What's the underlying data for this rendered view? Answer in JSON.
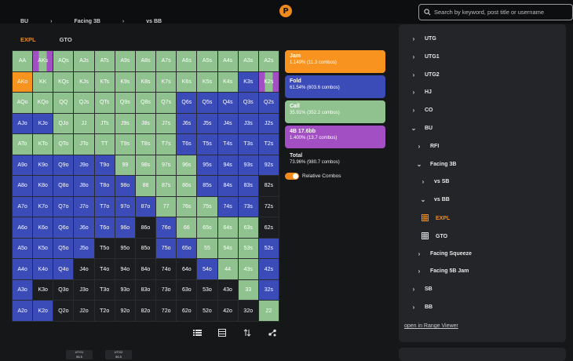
{
  "search": {
    "placeholder": "Search by keyword, post title or username"
  },
  "breadcrumb": {
    "items": [
      "BU",
      "Facing 3B",
      "vs BB"
    ]
  },
  "tabs": [
    {
      "label": "EXPL"
    },
    {
      "label": "GTO"
    }
  ],
  "legend": {
    "jam": {
      "label": "Jam",
      "value": "1.149% (11.3 combos)"
    },
    "fold": {
      "label": "Fold",
      "value": "61.54% (603.6 combos)"
    },
    "call": {
      "label": "Call",
      "value": "35.91% (352.2 combos)"
    },
    "fourbet": {
      "label": "4B 17.6bb",
      "value": "1.400% (13.7 combos)"
    },
    "total": {
      "label": "Total",
      "value": "73.96% (980.7 combos)"
    },
    "relative_combos": "Relative Combos"
  },
  "colors": {
    "jam": "#f7931e",
    "fold": "#3b4bb8",
    "call": "#8fc28e",
    "fourbet": "#a34fc4",
    "null": "#1c1d20",
    "accent": "#f08a1c"
  },
  "hand_grid": {
    "rows": [
      [
        "AA",
        "AKs",
        "AQs",
        "AJs",
        "ATs",
        "A9s",
        "A8s",
        "A7s",
        "A6s",
        "A5s",
        "A4s",
        "A3s",
        "A2s"
      ],
      [
        "AKo",
        "KK",
        "KQs",
        "KJs",
        "KTs",
        "K9s",
        "K8s",
        "K7s",
        "K6s",
        "K5s",
        "K4s",
        "K3s",
        "K2s"
      ],
      [
        "AQo",
        "KQo",
        "QQ",
        "QJs",
        "QTs",
        "Q9s",
        "Q8s",
        "Q7s",
        "Q6s",
        "Q5s",
        "Q4s",
        "Q3s",
        "Q2s"
      ],
      [
        "AJo",
        "KJo",
        "QJo",
        "JJ",
        "JTs",
        "J9s",
        "J8s",
        "J7s",
        "J6s",
        "J5s",
        "J4s",
        "J3s",
        "J2s"
      ],
      [
        "ATo",
        "KTo",
        "QTo",
        "JTo",
        "TT",
        "T9s",
        "T8s",
        "T7s",
        "T6s",
        "T5s",
        "T4s",
        "T3s",
        "T2s"
      ],
      [
        "A9o",
        "K9o",
        "Q9o",
        "J9o",
        "T9o",
        "99",
        "98s",
        "97s",
        "96s",
        "95s",
        "94s",
        "93s",
        "92s"
      ],
      [
        "A8o",
        "K8o",
        "Q8o",
        "J8o",
        "T8o",
        "98o",
        "88",
        "87s",
        "86s",
        "85s",
        "84s",
        "83s",
        "82s"
      ],
      [
        "A7o",
        "K7o",
        "Q7o",
        "J7o",
        "T7o",
        "97o",
        "87o",
        "77",
        "76s",
        "75s",
        "74s",
        "73s",
        "72s"
      ],
      [
        "A6o",
        "K6o",
        "Q6o",
        "J6o",
        "T6o",
        "96o",
        "86o",
        "76o",
        "66",
        "65s",
        "64s",
        "63s",
        "62s"
      ],
      [
        "A5o",
        "K5o",
        "Q5o",
        "J5o",
        "T5o",
        "95o",
        "85o",
        "75o",
        "65o",
        "55",
        "54s",
        "53s",
        "52s"
      ],
      [
        "A4o",
        "K4o",
        "Q4o",
        "J4o",
        "T4o",
        "94o",
        "84o",
        "74o",
        "64o",
        "54o",
        "44",
        "43s",
        "42s"
      ],
      [
        "A3o",
        "K3o",
        "Q3o",
        "J3o",
        "T3o",
        "93o",
        "83o",
        "73o",
        "63o",
        "53o",
        "43o",
        "33",
        "32s"
      ],
      [
        "A2o",
        "K2o",
        "Q2o",
        "J2o",
        "T2o",
        "92o",
        "82o",
        "72o",
        "62o",
        "52o",
        "42o",
        "32o",
        "22"
      ]
    ],
    "actions": [
      [
        "C",
        "F4",
        "C",
        "C",
        "C",
        "C",
        "C",
        "C",
        "C",
        "C",
        "C",
        "C",
        "C"
      ],
      [
        "J",
        "C",
        "C",
        "C",
        "C",
        "C",
        "C",
        "C",
        "C",
        "C",
        "C",
        "F",
        "F4"
      ],
      [
        "C",
        "C",
        "C",
        "C",
        "C",
        "C",
        "C",
        "C",
        "F",
        "F",
        "F",
        "F",
        "F"
      ],
      [
        "F",
        "F",
        "C",
        "C",
        "C",
        "C",
        "C",
        "C",
        "F",
        "F",
        "F",
        "F",
        "F"
      ],
      [
        "C",
        "C",
        "C",
        "C",
        "C",
        "C",
        "C",
        "C",
        "F",
        "F",
        "F",
        "F",
        "F"
      ],
      [
        "F",
        "F",
        "F",
        "F",
        "F",
        "C",
        "C",
        "C",
        "C",
        "F",
        "F",
        "F",
        "F"
      ],
      [
        "F",
        "F",
        "F",
        "F",
        "F",
        "F",
        "C",
        "C",
        "C",
        "F",
        "F",
        "F",
        "N"
      ],
      [
        "F",
        "F",
        "F",
        "F",
        "F",
        "F",
        "F",
        "C",
        "C",
        "C",
        "F",
        "F",
        "N"
      ],
      [
        "F",
        "F",
        "F",
        "F",
        "F",
        "F",
        "N",
        "F",
        "C",
        "C",
        "C",
        "C",
        "N"
      ],
      [
        "F",
        "F",
        "F",
        "F",
        "N",
        "N",
        "N",
        "F",
        "F",
        "C",
        "C",
        "C",
        "F"
      ],
      [
        "F",
        "F",
        "F",
        "N",
        "N",
        "N",
        "N",
        "N",
        "N",
        "F",
        "C",
        "C",
        "F"
      ],
      [
        "F",
        "N",
        "N",
        "N",
        "N",
        "N",
        "N",
        "N",
        "N",
        "N",
        "N",
        "C",
        "F"
      ],
      [
        "F",
        "F",
        "N",
        "N",
        "N",
        "N",
        "N",
        "N",
        "N",
        "N",
        "N",
        "N",
        "C"
      ]
    ]
  },
  "sidebar": {
    "nodes": [
      {
        "label": "UTG",
        "level": 0,
        "arrow": "›"
      },
      {
        "label": "UTG1",
        "level": 0,
        "arrow": "›"
      },
      {
        "label": "UTG2",
        "level": 0,
        "arrow": "›"
      },
      {
        "label": "HJ",
        "level": 0,
        "arrow": "›"
      },
      {
        "label": "CO",
        "level": 0,
        "arrow": "›"
      },
      {
        "label": "BU",
        "level": 0,
        "arrow": "⌄"
      },
      {
        "label": "RFI",
        "level": 1,
        "arrow": "›"
      },
      {
        "label": "Facing 3B",
        "level": 1,
        "arrow": "⌄"
      },
      {
        "label": "vs SB",
        "level": 2,
        "arrow": "›"
      },
      {
        "label": "vs BB",
        "level": 2,
        "arrow": "⌄"
      },
      {
        "label": "EXPL",
        "level": 3,
        "arrow": "grid"
      },
      {
        "label": "GTO",
        "level": 3,
        "arrow": "grid"
      },
      {
        "label": "Facing Squeeze",
        "level": 1,
        "arrow": "›"
      },
      {
        "label": "Facing 5B Jam",
        "level": 1,
        "arrow": "›"
      },
      {
        "label": "SB",
        "level": 0,
        "arrow": "›"
      },
      {
        "label": "BB",
        "level": 0,
        "arrow": "›"
      }
    ],
    "range_link": "open in Range Viewer"
  },
  "bottom": {
    "chips": [
      {
        "label": "UTG1",
        "value": "56.5"
      },
      {
        "label": "UTG2",
        "value": "56.5"
      }
    ]
  }
}
